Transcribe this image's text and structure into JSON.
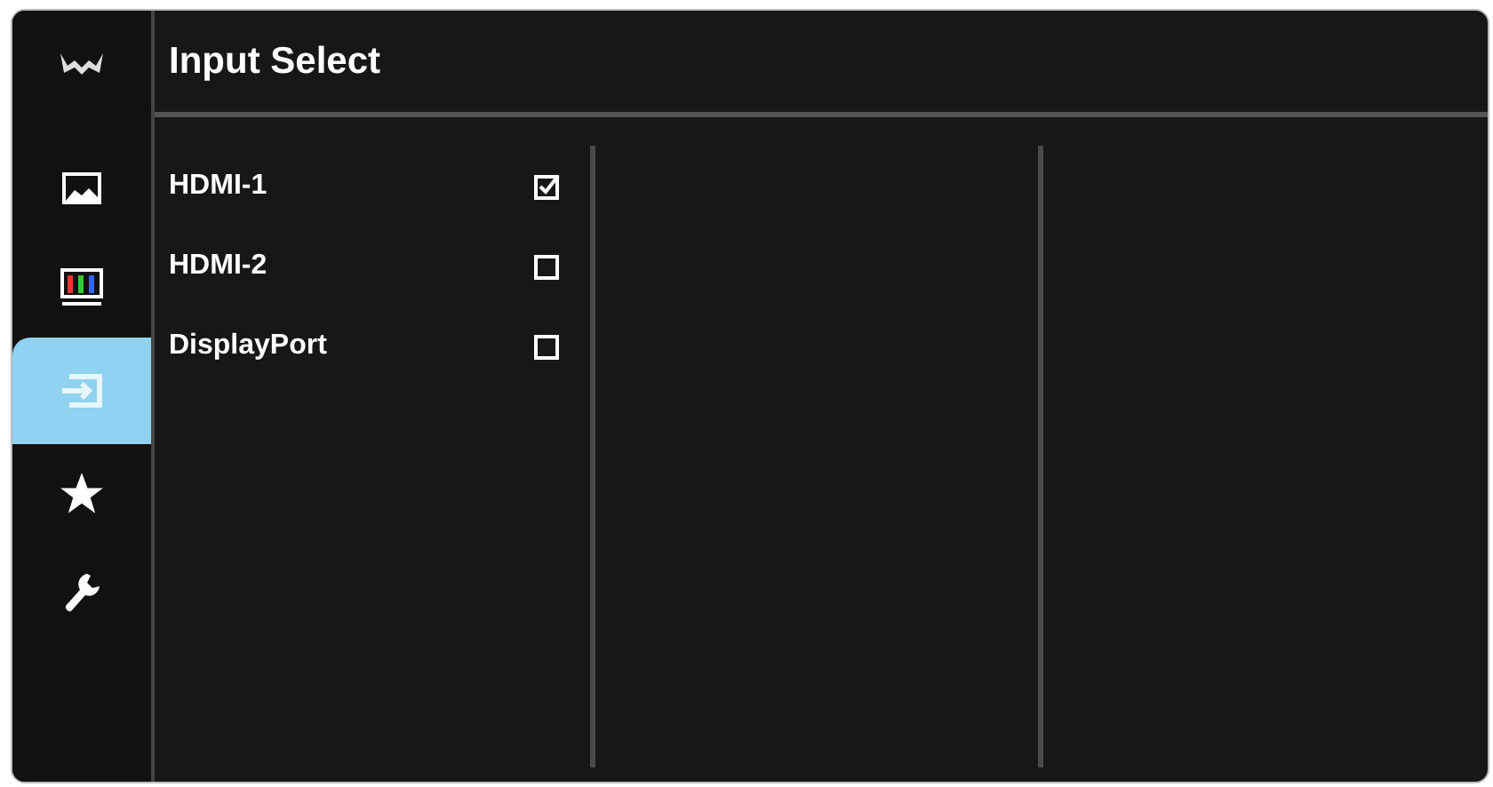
{
  "title": "Input Select",
  "sidebar": {
    "items": [
      {
        "kind": "picture",
        "selected": false
      },
      {
        "kind": "color",
        "selected": false
      },
      {
        "kind": "input",
        "selected": true
      },
      {
        "kind": "favorite",
        "selected": false
      },
      {
        "kind": "setup",
        "selected": false
      }
    ]
  },
  "options": [
    {
      "label": "HDMI-1",
      "checked": true
    },
    {
      "label": "HDMI-2",
      "checked": false
    },
    {
      "label": "DisplayPort",
      "checked": false
    }
  ]
}
